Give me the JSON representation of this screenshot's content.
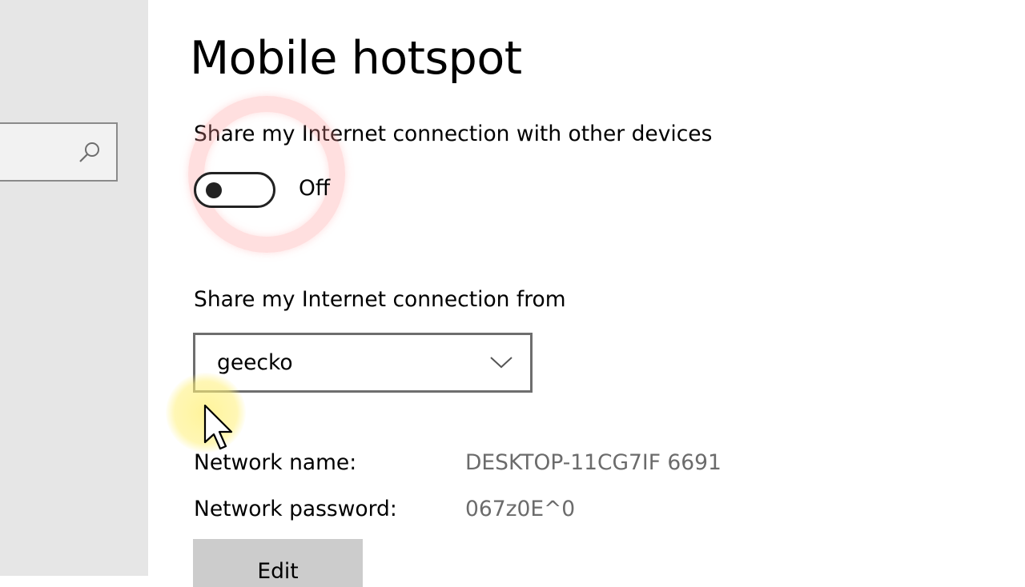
{
  "page": {
    "title": "Mobile hotspot"
  },
  "sharing": {
    "label": "Share my Internet connection with other devices",
    "toggle_state": "Off",
    "toggle_on": false
  },
  "connection_source": {
    "label": "Share my Internet connection from",
    "selected": "geecko"
  },
  "network": {
    "name_label": "Network name:",
    "name_value": "DESKTOP-11CG7IF 6691",
    "password_label": "Network password:",
    "password_value": "067z0E^0",
    "edit_label": "Edit"
  },
  "icons": {
    "search": "search-icon",
    "dropdown": "chevron-down-icon",
    "cursor": "mouse-pointer-icon"
  },
  "colors": {
    "sidebar_bg": "#e6e6e6",
    "value_text": "#6b6b6b",
    "button_bg": "#cccccc"
  }
}
